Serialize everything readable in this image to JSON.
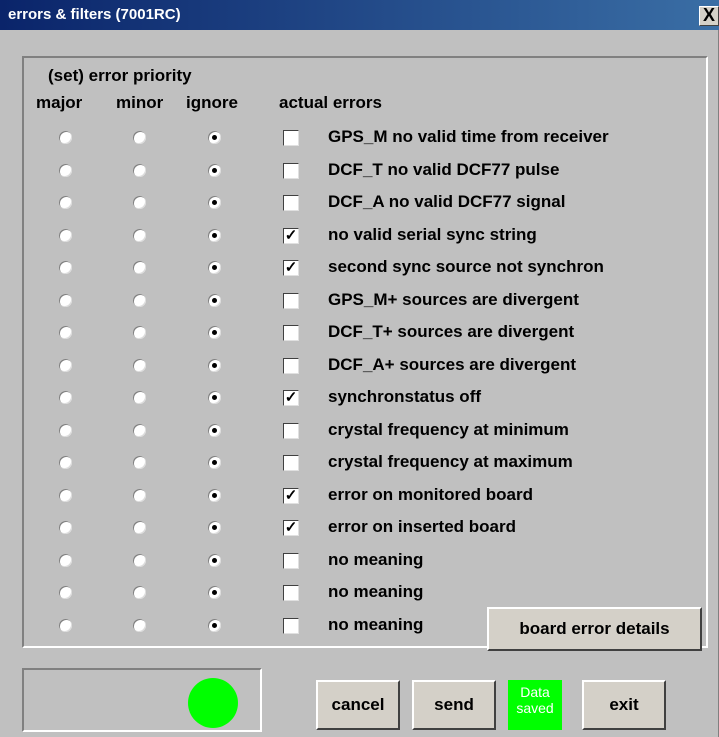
{
  "window": {
    "title": "errors & filters (7001RC)",
    "close_label": "X"
  },
  "headers": {
    "set_priority": "(set) error priority",
    "major": "major",
    "minor": "minor",
    "ignore": "ignore",
    "actual_errors": "actual errors"
  },
  "rows": [
    {
      "label": "GPS_M no valid time from receiver",
      "priority": "ignore",
      "checked": false
    },
    {
      "label": "DCF_T no valid DCF77 pulse",
      "priority": "ignore",
      "checked": false
    },
    {
      "label": "DCF_A no valid DCF77 signal",
      "priority": "ignore",
      "checked": false
    },
    {
      "label": "no valid serial sync string",
      "priority": "ignore",
      "checked": true
    },
    {
      "label": "second sync source not synchron",
      "priority": "ignore",
      "checked": true
    },
    {
      "label": "GPS_M+ sources are divergent",
      "priority": "ignore",
      "checked": false
    },
    {
      "label": "DCF_T+ sources are divergent",
      "priority": "ignore",
      "checked": false
    },
    {
      "label": "DCF_A+ sources are divergent",
      "priority": "ignore",
      "checked": false
    },
    {
      "label": "synchronstatus off",
      "priority": "ignore",
      "checked": true
    },
    {
      "label": "crystal frequency at minimum",
      "priority": "ignore",
      "checked": false
    },
    {
      "label": "crystal frequency at maximum",
      "priority": "ignore",
      "checked": false
    },
    {
      "label": "error on monitored board",
      "priority": "ignore",
      "checked": true
    },
    {
      "label": "error on inserted board",
      "priority": "ignore",
      "checked": true
    },
    {
      "label": "no meaning",
      "priority": "ignore",
      "checked": false
    },
    {
      "label": "no meaning",
      "priority": "ignore",
      "checked": false
    },
    {
      "label": "no meaning",
      "priority": "ignore",
      "checked": false
    }
  ],
  "buttons": {
    "board_error_details": "board error details",
    "cancel": "cancel",
    "send": "send",
    "exit": "exit"
  },
  "status": {
    "data_saved_line1": "Data",
    "data_saved_line2": "saved",
    "led_color": "#00ff00"
  }
}
